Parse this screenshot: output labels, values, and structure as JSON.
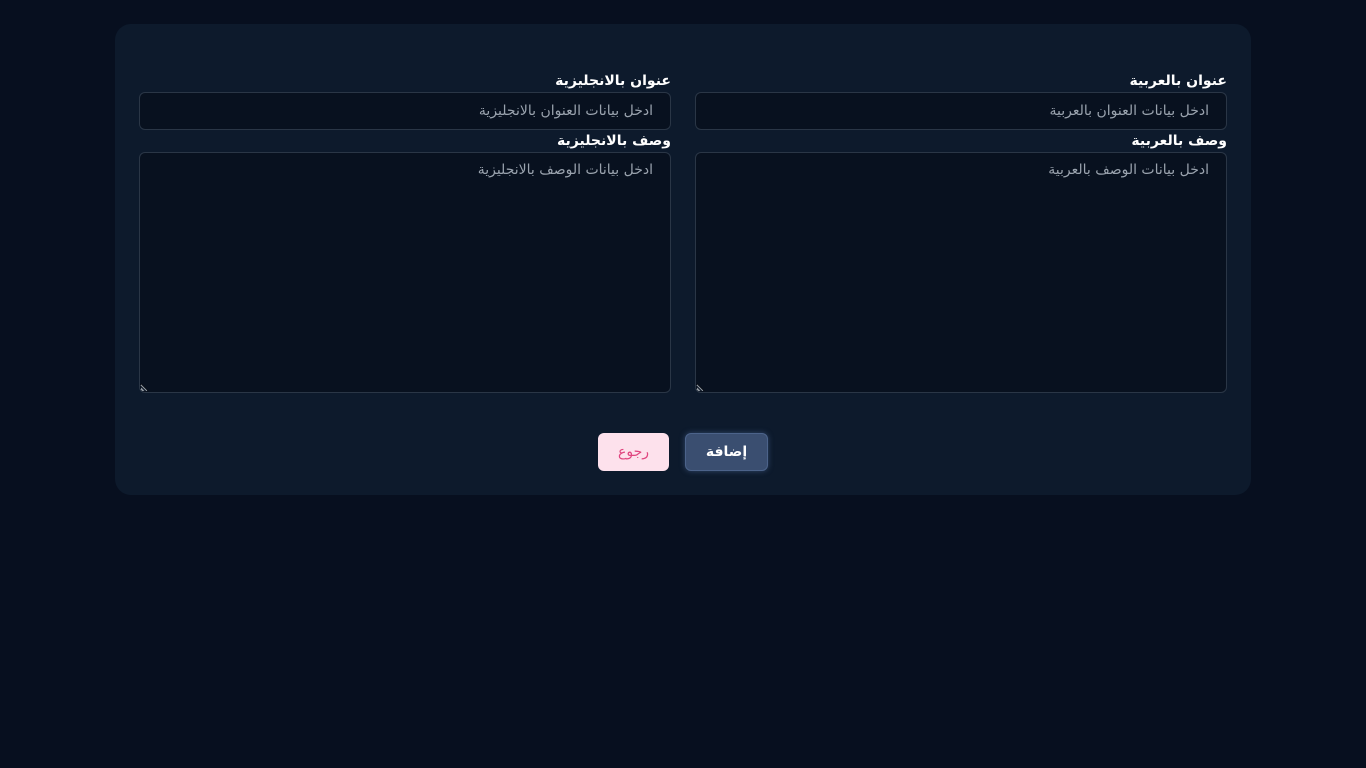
{
  "form": {
    "title_ar": {
      "label": "عنوان بالعربية",
      "placeholder": "ادخل بيانات العنوان بالعربية",
      "value": ""
    },
    "title_en": {
      "label": "عنوان بالانجليزية",
      "placeholder": "ادخل بيانات العنوان بالانجليزية",
      "value": ""
    },
    "desc_ar": {
      "label": "وصف بالعربية",
      "placeholder": "ادخل بيانات الوصف بالعربية",
      "value": ""
    },
    "desc_en": {
      "label": "وصف بالانجليزية",
      "placeholder": "ادخل بيانات الوصف بالانجليزية",
      "value": ""
    }
  },
  "actions": {
    "add_label": "إضافة",
    "back_label": "رجوع"
  },
  "colors": {
    "page_background": "#070f1f",
    "card_background": "#0d1a2c",
    "primary_button": "#3a4e70",
    "back_button_background": "#fde1ec",
    "back_button_text": "#e0457f"
  }
}
